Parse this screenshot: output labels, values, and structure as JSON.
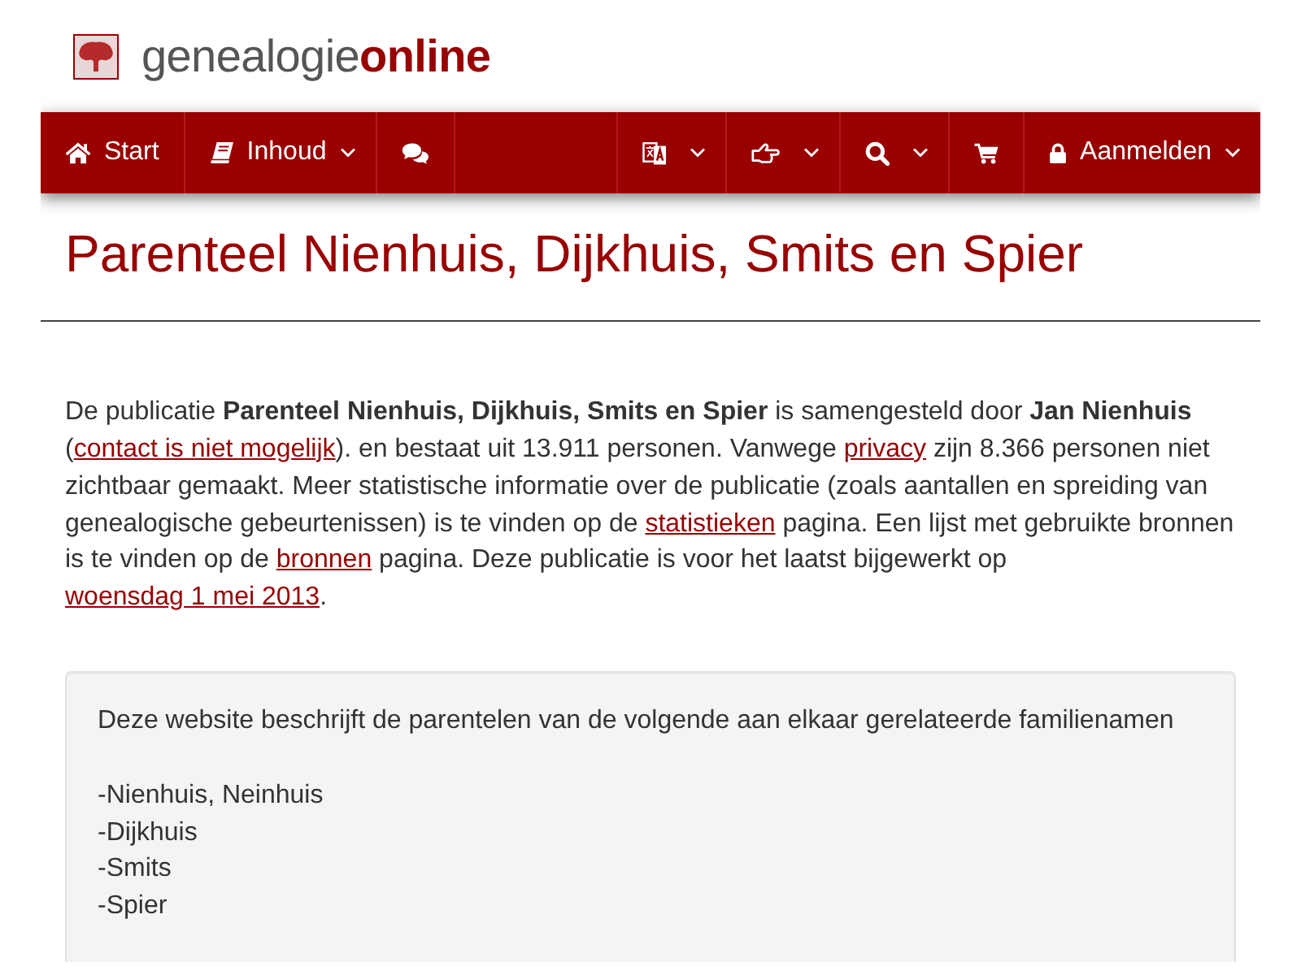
{
  "logo": {
    "text": "genealogie**online**"
  },
  "nav": {
    "left": [
      {
        "kind": "home",
        "label": "Start",
        "dropdown": false
      },
      {
        "kind": "book",
        "label": "Inhoud",
        "dropdown": true
      },
      {
        "kind": "chat",
        "dropdown": false
      }
    ],
    "right": [
      {
        "kind": "language",
        "dropdown": true
      },
      {
        "kind": "hand",
        "dropdown": true
      },
      {
        "kind": "search",
        "dropdown": true
      },
      {
        "kind": "cart",
        "dropdown": false
      },
      {
        "kind": "lock",
        "label": "Aanmelden",
        "dropdown": true
      }
    ]
  },
  "title": "Parenteel Nienhuis, Dijkhuis, Smits en Spier",
  "description": [
    {
      "kind": "text",
      "text": "De publicatie **Parenteel Nienhuis, Dijkhuis, Smits en Spier** is samengesteld door **Jan Nienhuis** ("
    },
    {
      "kind": "link",
      "text": "contact is niet mogelijk"
    },
    {
      "kind": "text",
      "text": "). en bestaat uit 13.911 personen. Vanwege "
    },
    {
      "kind": "link",
      "text": "privacy"
    },
    {
      "kind": "text",
      "text": " zijn 8.366 personen niet zichtbaar gemaakt. Meer statistische informatie over de publicatie (zoals aantallen en spreiding van genealogische gebeurtenissen) is te vinden op de "
    },
    {
      "kind": "link",
      "text": "statistieken"
    },
    {
      "kind": "text",
      "text": " pagina. Een lijst met gebruikte bronnen is te vinden op de "
    },
    {
      "kind": "link",
      "text": "bronnen"
    },
    {
      "kind": "text",
      "text": " pagina. Deze publicatie is voor het laatst bijgewerkt op "
    },
    {
      "kind": "link",
      "text": "woensdag 1 mei 2013"
    },
    {
      "kind": "text",
      "text": "."
    }
  ],
  "card": {
    "intro": "Deze website beschrijft de parentelen van de volgende aan elkaar gerelateerde familienamen",
    "names": [
      "-Nienhuis, Neinhuis",
      "-Dijkhuis",
      "-Smits",
      "-Spier"
    ]
  }
}
